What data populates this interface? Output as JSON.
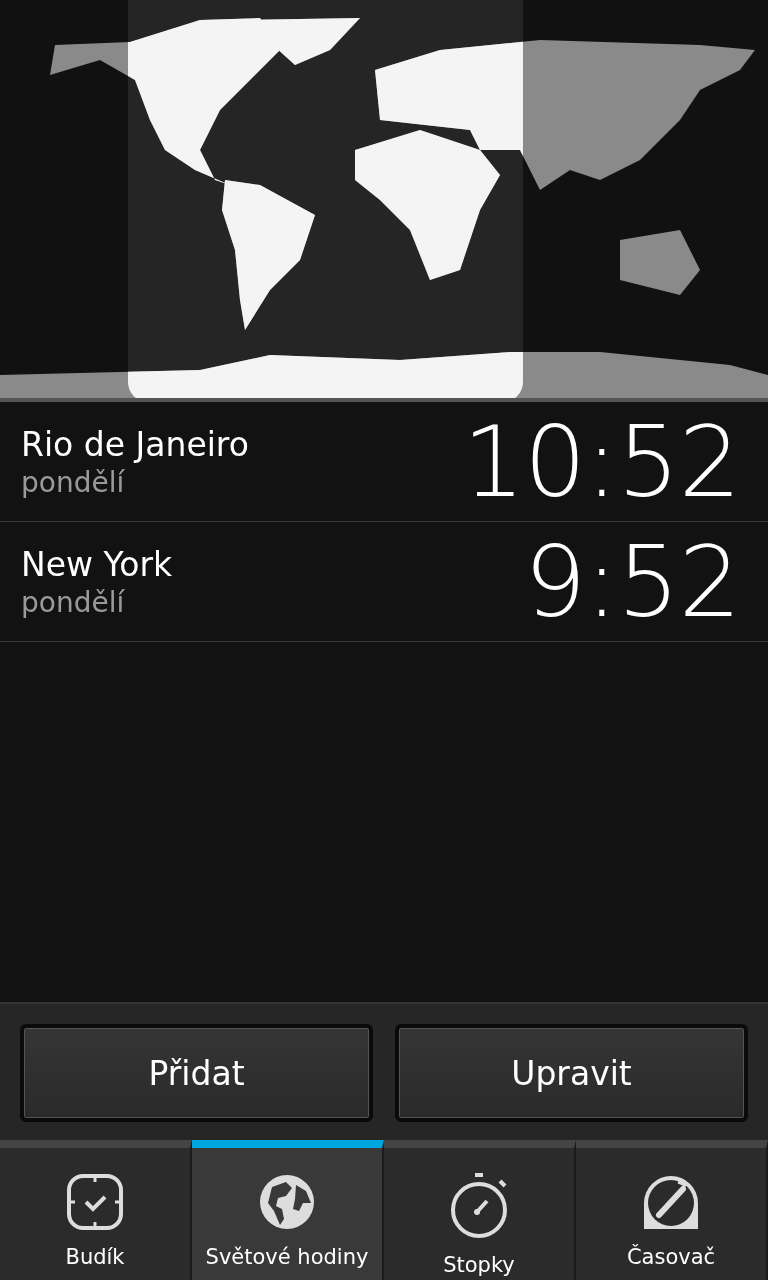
{
  "cities": [
    {
      "name": "Rio de Janeiro",
      "day": "pondělí",
      "time": "10:52"
    },
    {
      "name": "New York",
      "day": "pondělí",
      "time": "9:52"
    }
  ],
  "buttons": [
    "Přidat",
    "Upravit"
  ],
  "tabs": [
    {
      "label": "Budík",
      "kind": "alarm",
      "selected": false
    },
    {
      "label": "Světové hodiny",
      "kind": "globe",
      "selected": true
    },
    {
      "label": "Stopky",
      "kind": "stopwatch",
      "selected": false
    },
    {
      "label": "Časovač",
      "kind": "timer",
      "selected": false
    }
  ]
}
